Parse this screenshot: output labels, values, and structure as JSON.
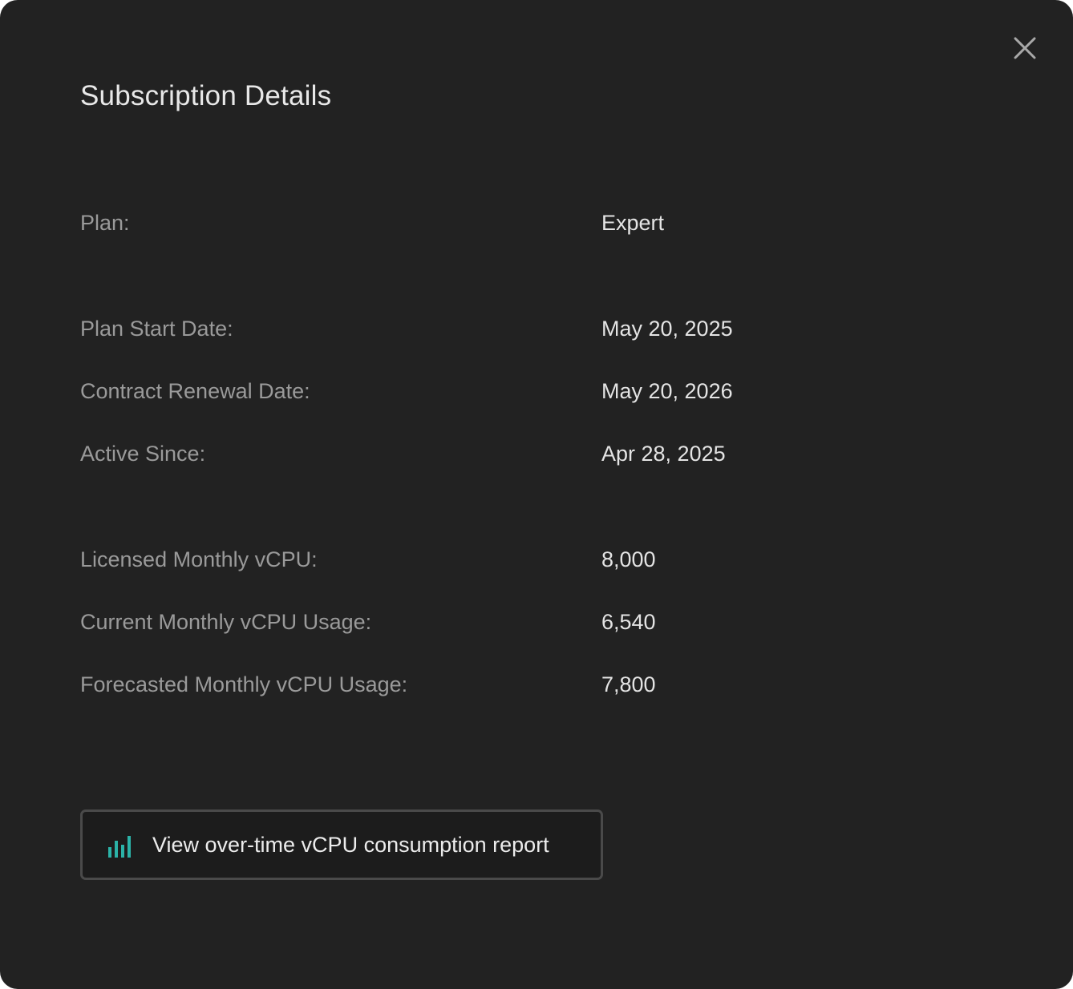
{
  "dialog": {
    "title": "Subscription Details",
    "close_icon": "close-icon"
  },
  "details": {
    "plan": {
      "label": "Plan:",
      "value": "Expert"
    },
    "plan_start_date": {
      "label": "Plan Start Date:",
      "value": "May 20, 2025"
    },
    "contract_renewal_date": {
      "label": "Contract Renewal Date:",
      "value": "May 20, 2026"
    },
    "active_since": {
      "label": "Active Since:",
      "value": "Apr 28, 2025"
    },
    "licensed_monthly_vcpu": {
      "label": "Licensed Monthly vCPU:",
      "value": "8,000"
    },
    "current_monthly_vcpu_usage": {
      "label": "Current Monthly vCPU Usage:",
      "value": "6,540"
    },
    "forecasted_monthly_vcpu_usage": {
      "label": "Forecasted Monthly vCPU Usage:",
      "value": "7,800"
    }
  },
  "report_button": {
    "label": "View over-time vCPU consumption report",
    "icon": "bar-chart-icon",
    "icon_color": "#2bb3a8"
  },
  "colors": {
    "background": "#222222",
    "label_text": "#9a9a9a",
    "value_text": "#e4e4e4",
    "accent": "#2bb3a8"
  }
}
